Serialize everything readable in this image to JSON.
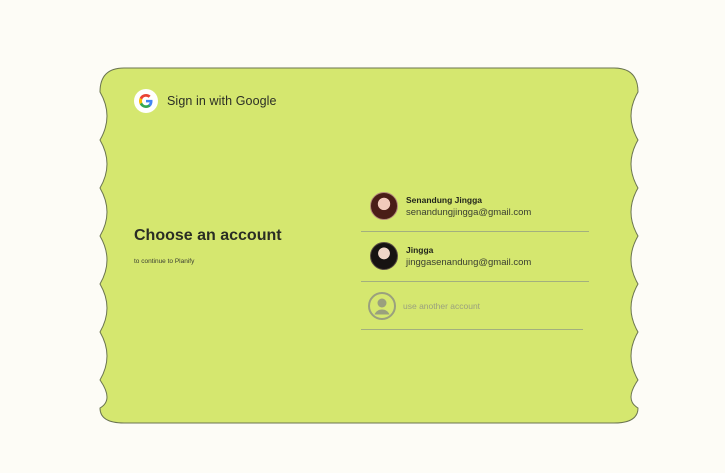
{
  "header": {
    "title": "Sign in with Google",
    "logo_icon": "google-g-icon"
  },
  "main": {
    "heading": "Choose an account",
    "subtitle": "to continue to Planify"
  },
  "accounts": [
    {
      "name": "Senandung Jingga",
      "email": "senandungjingga@gmail.com",
      "avatar": "avatar-photo"
    },
    {
      "name": "Jingga",
      "email": "jinggasenandung@gmail.com",
      "avatar": "avatar-photo"
    }
  ],
  "other_account": {
    "label": "use another account",
    "icon": "user-circle-icon"
  },
  "colors": {
    "page_background": "#fdfcf6",
    "card_background": "#d5e76f",
    "card_border": "#6a7450",
    "divider": "#a3b07e",
    "muted_text": "#9aa07e"
  }
}
